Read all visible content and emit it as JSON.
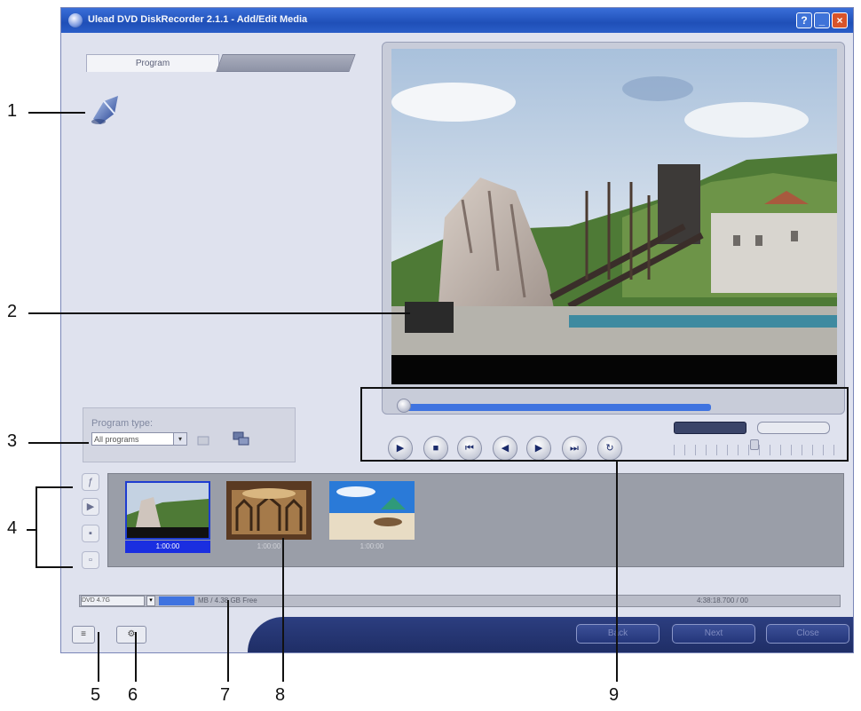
{
  "window": {
    "title": "Ulead DVD DiskRecorder 2.1.1 - Add/Edit Media",
    "help_glyph": "?",
    "min_glyph": "_",
    "close_glyph": "×"
  },
  "tabs": [
    {
      "label": "Program",
      "active": true
    },
    {
      "label": "",
      "active": false
    }
  ],
  "program_type": {
    "label": "Program type:",
    "value": "All programs",
    "arrow": "▾"
  },
  "playback": {
    "controls": [
      {
        "name": "play",
        "glyph": "▶"
      },
      {
        "name": "stop",
        "glyph": "■"
      },
      {
        "name": "home",
        "glyph": "⏮"
      },
      {
        "name": "prev-frame",
        "glyph": "◀"
      },
      {
        "name": "next-frame",
        "glyph": "▶"
      },
      {
        "name": "end",
        "glyph": "⏭"
      },
      {
        "name": "repeat",
        "glyph": "↻"
      }
    ],
    "progress": 0.85
  },
  "side_tools": [
    "ƒ",
    "▶",
    "▪",
    "▫"
  ],
  "storyboard": {
    "clips": [
      {
        "caption": "1:00:00",
        "selected": true
      },
      {
        "caption": "1:00:00",
        "selected": false
      },
      {
        "caption": "1:00:00",
        "selected": false
      }
    ]
  },
  "status": {
    "disc_type": "DVD 4.7G",
    "arrow": "▾",
    "space": "MB / 4.38 GB Free",
    "time": "4:38:18.700 / 00"
  },
  "bottom": {
    "tool1_glyph": "≡",
    "tool2_glyph": "⚙",
    "back_label": "Back",
    "next_label": "Next",
    "close_label": "Close"
  },
  "callouts": [
    "1",
    "2",
    "3",
    "4",
    "5",
    "6",
    "7",
    "8",
    "9"
  ],
  "colors": {
    "titlebar": "#1f4fb8",
    "accent": "#3f73e0",
    "close": "#d8542a",
    "bottom_bar": "#24367a"
  }
}
